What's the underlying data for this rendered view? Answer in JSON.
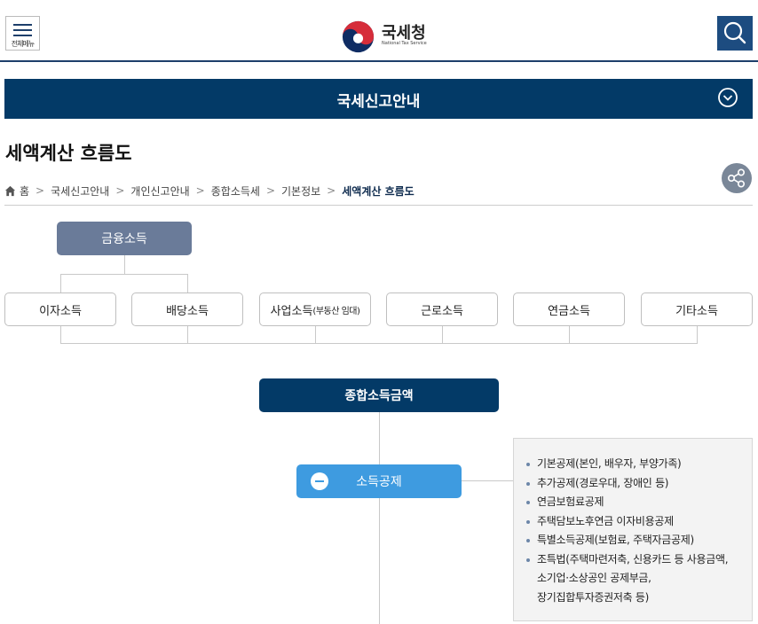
{
  "header": {
    "menu_label": "전체메뉴",
    "logo_title": "국세청",
    "logo_subtitle": "National Tax Service"
  },
  "section": {
    "title": "국세신고안내"
  },
  "page": {
    "title": "세액계산 흐름도"
  },
  "breadcrumb": [
    "홈",
    "국세신고안내",
    "개인신고안내",
    "종합소득세",
    "기본정보",
    "세액계산 흐름도"
  ],
  "flow": {
    "top": "금융소득",
    "income_types": [
      {
        "main": "이자소득",
        "sub": ""
      },
      {
        "main": "배당소득",
        "sub": ""
      },
      {
        "main": "사업소득",
        "sub": "(부동산 임대)"
      },
      {
        "main": "근로소득",
        "sub": ""
      },
      {
        "main": "연금소득",
        "sub": ""
      },
      {
        "main": "기타소득",
        "sub": ""
      }
    ],
    "total": "종합소득금액",
    "deduction": "소득공제",
    "deduction_items": [
      "기본공제(본인, 배우자, 부양가족)",
      "추가공제(경로우대, 장애인 등)",
      "연금보험료공제",
      "주택담보노후연금 이자비용공제",
      "특별소득공제(보험료, 주택자금공제)",
      "조특법(주택마련저축, 신용카드 등 사용금액,",
      "소기업·소상공인 공제부금,",
      "장기집합투자증권저축 등)"
    ]
  },
  "colors": {
    "navy": "#033a67",
    "top_box": "#6a7b99",
    "deduction_box": "#3e9be0"
  }
}
